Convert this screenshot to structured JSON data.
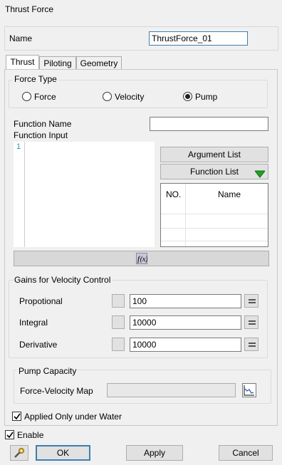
{
  "window": {
    "title": "Thrust Force"
  },
  "name": {
    "label": "Name",
    "value": "ThrustForce_01"
  },
  "tabs": [
    {
      "label": "Thrust",
      "active": true
    },
    {
      "label": "Piloting",
      "active": false
    },
    {
      "label": "Geometry",
      "active": false
    }
  ],
  "force_type": {
    "legend": "Force Type",
    "options": [
      {
        "label": "Force",
        "checked": false
      },
      {
        "label": "Velocity",
        "checked": false
      },
      {
        "label": "Pump",
        "checked": true
      }
    ]
  },
  "function": {
    "name_label": "Function Name",
    "name_value": "",
    "input_label": "Function Input",
    "line_number": "1",
    "argument_list_label": "Argument List",
    "function_list_label": "Function List",
    "table_headers": [
      "NO.",
      "Name"
    ],
    "fx_label": "f(x)"
  },
  "gains": {
    "legend": "Gains for Velocity Control",
    "rows": [
      {
        "label": "Propotional",
        "value": "100"
      },
      {
        "label": "Integral",
        "value": "10000"
      },
      {
        "label": "Derivative",
        "value": "10000"
      }
    ]
  },
  "pump": {
    "legend": "Pump Capacity",
    "map_label": "Force-Velocity Map",
    "map_value": ""
  },
  "applied_under_water": {
    "label": "Applied Only under Water",
    "checked": true
  },
  "enable": {
    "label": "Enable",
    "checked": true
  },
  "buttons": {
    "ok": "OK",
    "apply": "Apply",
    "cancel": "Cancel"
  },
  "colors": {
    "accent": "#3c7fb1",
    "dropdown_arrow": "#22a022"
  }
}
